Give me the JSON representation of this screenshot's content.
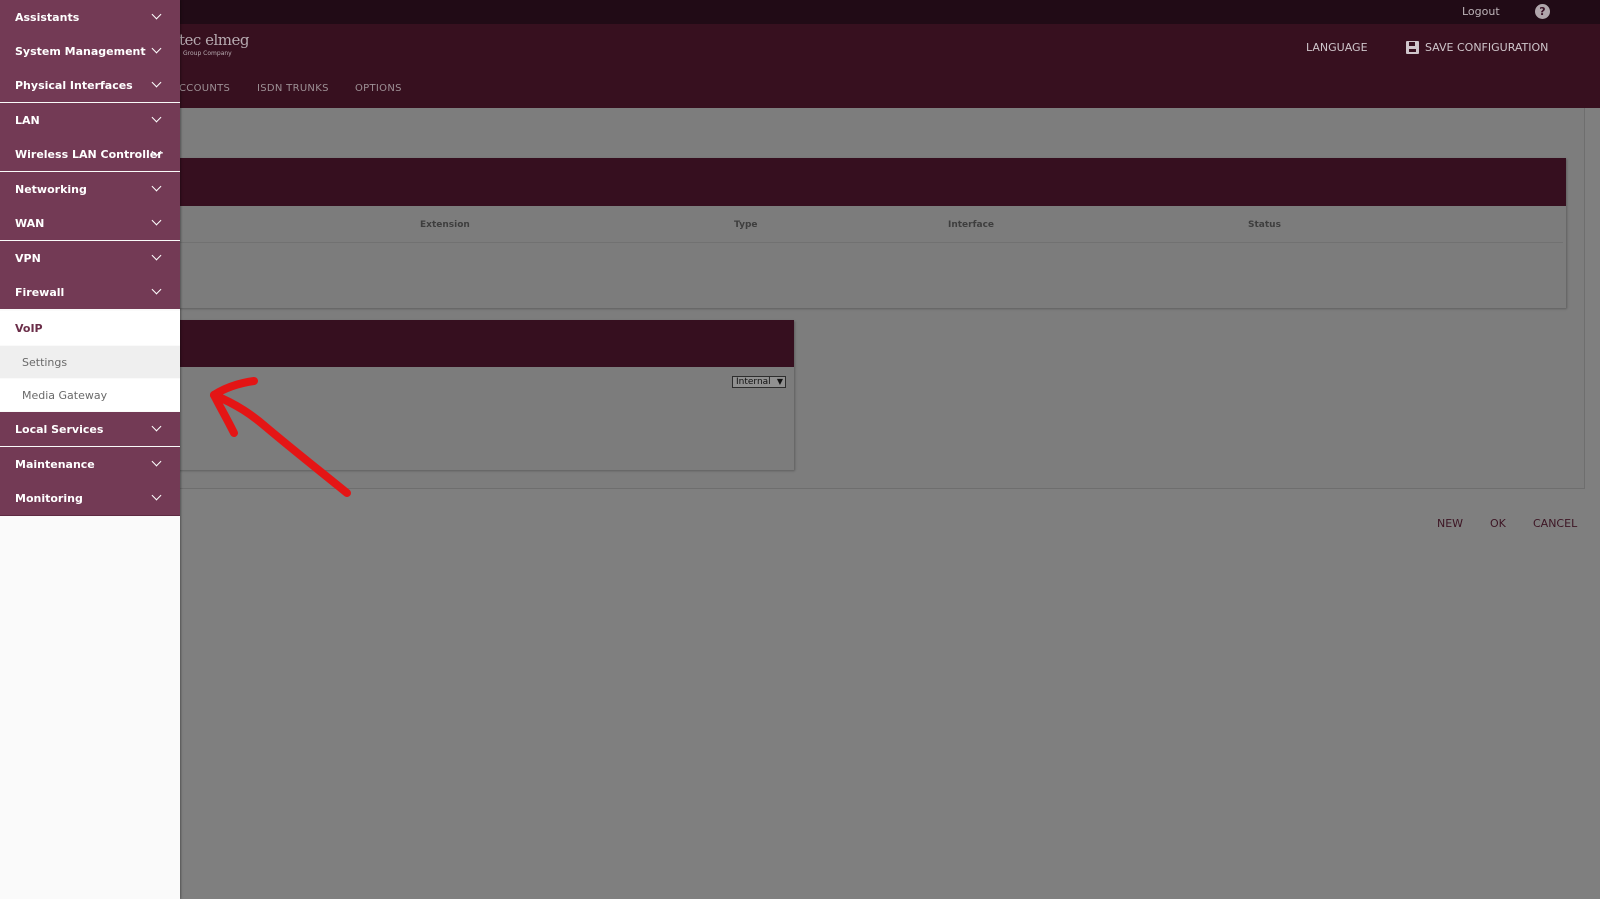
{
  "topbar": {
    "logout": "Logout",
    "help": "?"
  },
  "header": {
    "logo_main": "tec elmeg",
    "logo_sub": "Group Company",
    "language": "LANGUAGE",
    "save_configuration": "SAVE CONFIGURATION",
    "tabs": [
      "CCOUNTS",
      "ISDN TRUNKS",
      "OPTIONS"
    ]
  },
  "table": {
    "columns": [
      "Extension",
      "Type",
      "Interface",
      "Status"
    ]
  },
  "select": {
    "value": "Internal"
  },
  "buttons": {
    "new": "NEW",
    "ok": "OK",
    "cancel": "CANCEL"
  },
  "sidebar": {
    "items": [
      {
        "label": "Assistants"
      },
      {
        "label": "System Management"
      },
      {
        "label": "Physical Interfaces"
      },
      {
        "label": "LAN"
      },
      {
        "label": "Wireless LAN Controller"
      },
      {
        "label": "Networking"
      },
      {
        "label": "WAN"
      },
      {
        "label": "VPN"
      },
      {
        "label": "Firewall"
      }
    ],
    "voip": {
      "label": "VoIP",
      "sub": [
        "Settings",
        "Media Gateway"
      ]
    },
    "items_after": [
      {
        "label": "Local Services"
      },
      {
        "label": "Maintenance"
      },
      {
        "label": "Monitoring"
      }
    ]
  },
  "colors": {
    "accent": "#733a55",
    "header": "#37101f",
    "annotation": "#e41515"
  }
}
